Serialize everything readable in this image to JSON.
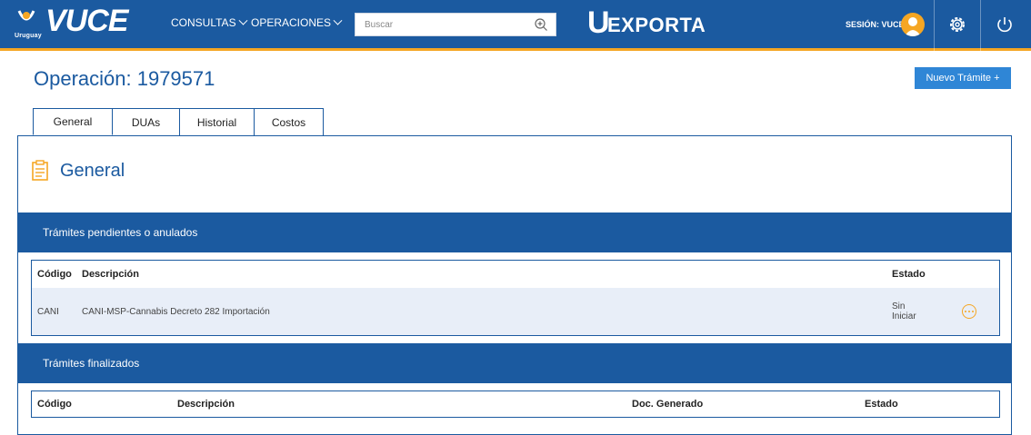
{
  "header": {
    "logo": {
      "brand": "VUCE",
      "country": "Uruguay"
    },
    "nav": [
      {
        "label": "CONSULTAS"
      },
      {
        "label": "OPERACIONES"
      }
    ],
    "search": {
      "placeholder": "Buscar"
    },
    "uexporta_logo": {
      "mark": "U",
      "text": "EXPORTA"
    },
    "session_label": "SESIÓN: VUCE",
    "colors": {
      "bar": "#1b5aa0",
      "accent": "#f5a623"
    }
  },
  "page": {
    "title": "Operación: 1979571",
    "new_button": "Nuevo Trámite +"
  },
  "tabs": [
    {
      "label": "General",
      "active": true
    },
    {
      "label": "DUAs",
      "active": false
    },
    {
      "label": "Historial",
      "active": false
    },
    {
      "label": "Costos",
      "active": false
    }
  ],
  "general": {
    "title": "General",
    "icon": "clipboard-icon"
  },
  "pending": {
    "heading": "Trámites pendientes o anulados",
    "columns": {
      "codigo": "Código",
      "descripcion": "Descripción",
      "estado": "Estado"
    },
    "rows": [
      {
        "codigo": "CANI",
        "descripcion": "CANI-MSP-Cannabis Decreto 282 Importación",
        "estado_1": "Sin",
        "estado_2": "Iniciar"
      }
    ]
  },
  "finished": {
    "heading": "Trámites finalizados",
    "columns": {
      "codigo": "Código",
      "descripcion": "Descripción",
      "doc": "Doc. Generado",
      "estado": "Estado"
    }
  }
}
